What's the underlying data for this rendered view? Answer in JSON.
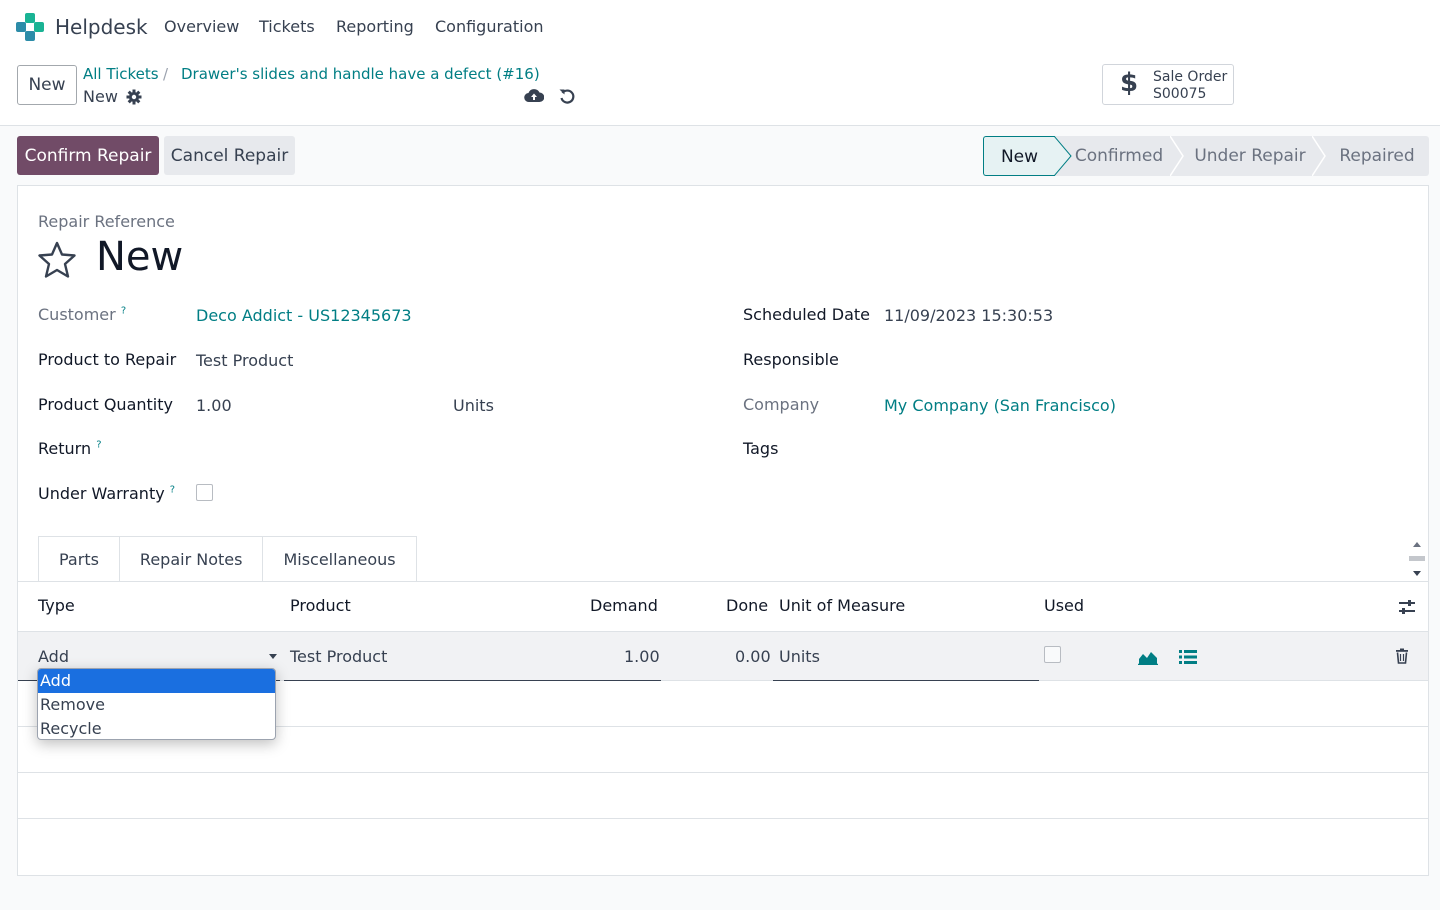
{
  "navbar": {
    "app_name": "Helpdesk",
    "menu": [
      "Overview",
      "Tickets",
      "Reporting",
      "Configuration"
    ]
  },
  "control": {
    "new_label": "New",
    "breadcrumb_parent": "All Tickets",
    "breadcrumb_separator": "/",
    "breadcrumb_ticket": "Drawer's slides and handle have a defect (#16)",
    "current_record": "New",
    "smart_button": {
      "title": "Sale Order",
      "value": "S00075",
      "icon": "dollar-icon"
    }
  },
  "actions": {
    "confirm_label": "Confirm Repair",
    "cancel_label": "Cancel Repair"
  },
  "status": {
    "stages": [
      "New",
      "Confirmed",
      "Under Repair",
      "Repaired"
    ],
    "current": "New"
  },
  "form": {
    "ref_label": "Repair Reference",
    "ref_value": "New",
    "customer_label": "Customer",
    "customer_value": "Deco Addict - US12345673",
    "product_label": "Product to Repair",
    "product_value": "Test Product",
    "qty_label": "Product Quantity",
    "qty_value": "1.00",
    "qty_uom": "Units",
    "return_label": "Return",
    "warranty_label": "Under Warranty",
    "warranty_checked": false,
    "scheduled_label": "Scheduled Date",
    "scheduled_value": "11/09/2023 15:30:53",
    "responsible_label": "Responsible",
    "company_label": "Company",
    "company_value": "My Company (San Francisco)",
    "tags_label": "Tags",
    "help_marker": "?"
  },
  "tabs": [
    "Parts",
    "Repair Notes",
    "Miscellaneous"
  ],
  "parts_table": {
    "columns": [
      "Type",
      "Product",
      "Demand",
      "Done",
      "Unit of Measure",
      "Used"
    ],
    "rows": [
      {
        "type": "Add",
        "product": "Test Product",
        "demand": "1.00",
        "done": "0.00",
        "uom": "Units",
        "used": false
      }
    ]
  },
  "type_dropdown": {
    "options": [
      "Add",
      "Remove",
      "Recycle"
    ],
    "selected": "Add"
  },
  "colors": {
    "brand": "#714b67",
    "link": "#017e84",
    "selected_option": "#1a6fe0"
  }
}
